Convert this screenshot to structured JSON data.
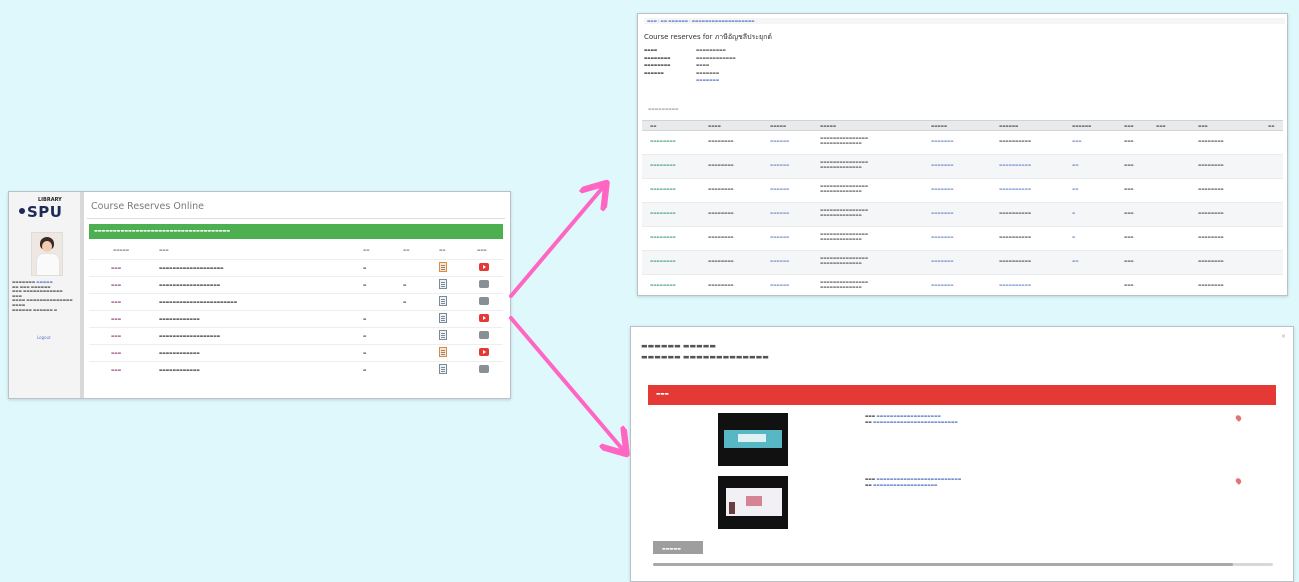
{
  "colors": {
    "background": "#def8fc",
    "arrow": "#ff66c4",
    "banner_green": "#4caf50",
    "bar_red": "#e53935"
  },
  "left_panel": {
    "logo_top": "LIBRARY",
    "logo_main": "SPU",
    "title": "Course Reserves Online",
    "side_link": "Logout",
    "rows": [
      {
        "icon_orange": true,
        "btn": "red"
      },
      {
        "icon_orange": false,
        "btn": "gray"
      },
      {
        "icon_orange": false,
        "btn": "gray"
      },
      {
        "icon_orange": false,
        "btn": "red"
      },
      {
        "icon_orange": false,
        "btn": "gray"
      },
      {
        "icon_orange": true,
        "btn": "red"
      },
      {
        "icon_orange": false,
        "btn": "gray"
      }
    ]
  },
  "top_right_panel": {
    "title": "Course reserves for ภาษีอัญชลีประยุกต์"
  },
  "bottom_right_panel": {
    "close_icon": "×",
    "videos": [
      {
        "thumb": "a"
      },
      {
        "thumb": "b"
      }
    ]
  }
}
